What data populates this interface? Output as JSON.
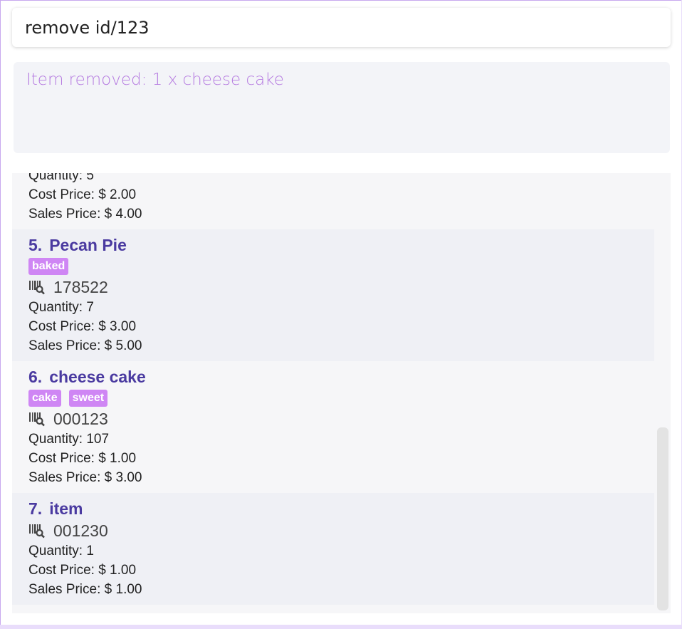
{
  "command": {
    "value": "remove id/123",
    "placeholder": ""
  },
  "result": {
    "message": "Item removed: 1 x cheese cake"
  },
  "partial_item": {
    "quantity": "Quantity: 5",
    "cost": "Cost Price: $ 2.00",
    "sales": "Sales Price: $ 4.00"
  },
  "items": [
    {
      "index": "5.",
      "name": "Pecan Pie",
      "tags": [
        "baked"
      ],
      "barcode": "178522",
      "quantity": "Quantity: 7",
      "cost": "Cost Price: $ 3.00",
      "sales": "Sales Price: $ 5.00"
    },
    {
      "index": "6.",
      "name": "cheese cake",
      "tags": [
        "cake",
        "sweet"
      ],
      "barcode": "000123",
      "quantity": "Quantity: 107",
      "cost": "Cost Price: $ 1.00",
      "sales": "Sales Price: $ 3.00"
    },
    {
      "index": "7.",
      "name": "item",
      "tags": [],
      "barcode": "001230",
      "quantity": "Quantity: 1",
      "cost": "Cost Price: $ 1.00",
      "sales": "Sales Price: $ 1.00"
    }
  ],
  "icons": {
    "barcode": "barcode-search-icon"
  },
  "colors": {
    "accent": "#4a3aa0",
    "tag_bg": "#cf86f4",
    "result_text": "#b57ae0",
    "border": "#c8a9ef"
  }
}
